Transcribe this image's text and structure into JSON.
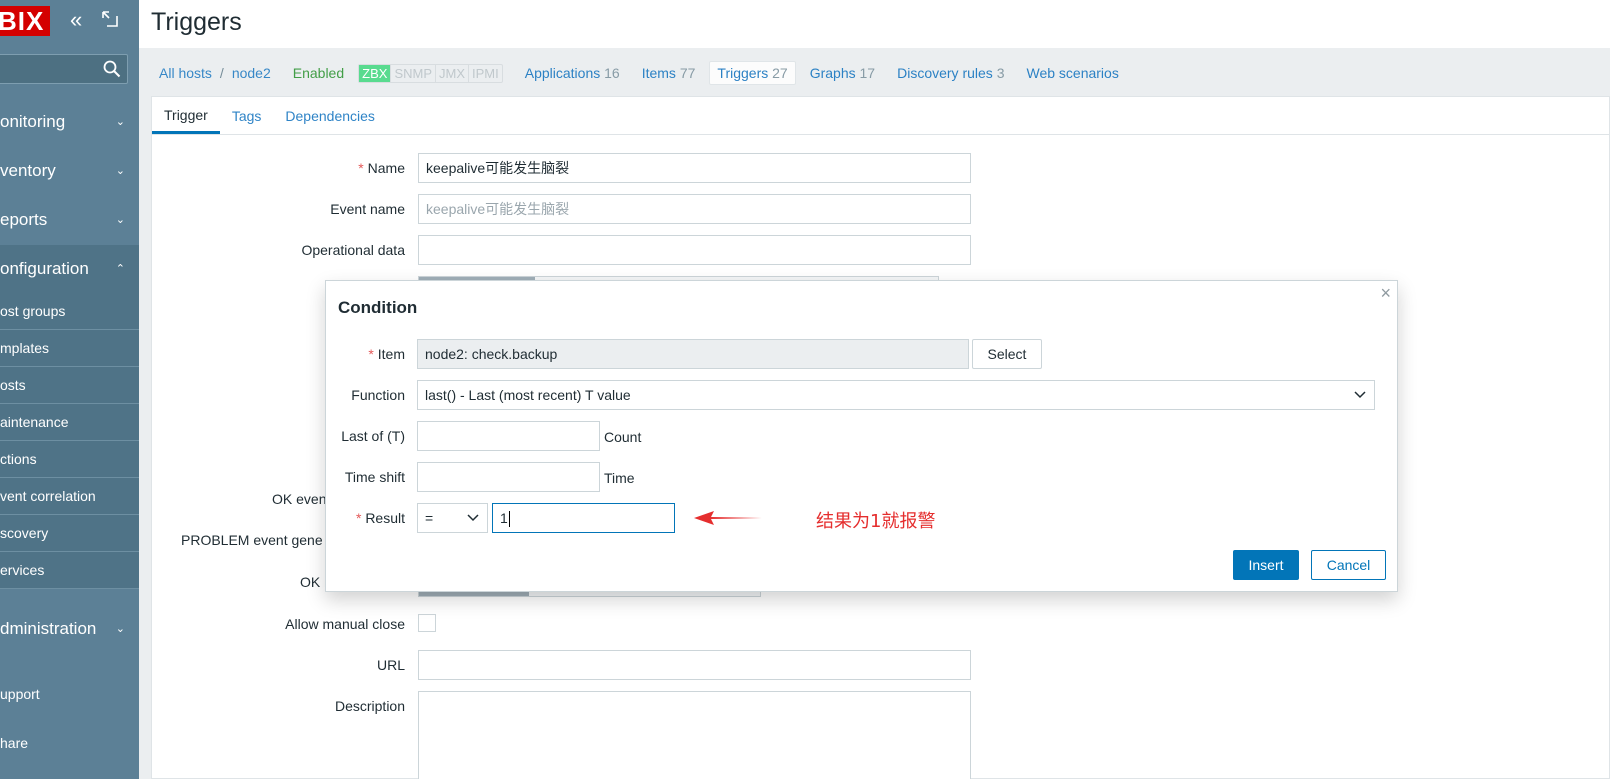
{
  "sidebar": {
    "logo": "BIX",
    "search_placeholder": "",
    "menu": [
      {
        "label": "onitoring",
        "chevron": "⌄"
      },
      {
        "label": "ventory",
        "chevron": "⌄"
      },
      {
        "label": "eports",
        "chevron": "⌄"
      },
      {
        "label": "onfiguration",
        "chevron": "⌃"
      },
      {
        "label": "dministration",
        "chevron": "⌄"
      }
    ],
    "submenu": [
      "ost groups",
      "mplates",
      "osts",
      "aintenance",
      "ctions",
      "vent correlation",
      "scovery",
      "ervices"
    ],
    "support": "upport",
    "share": "hare"
  },
  "page": {
    "title": "Triggers"
  },
  "host_nav": {
    "all_hosts": "All hosts",
    "separator": "/",
    "host": "node2",
    "status": "Enabled",
    "availability": [
      "ZBX",
      "SNMP",
      "JMX",
      "IPMI"
    ],
    "tabs": [
      {
        "label": "Applications",
        "count": "16"
      },
      {
        "label": "Items",
        "count": "77"
      },
      {
        "label": "Triggers",
        "count": "27"
      },
      {
        "label": "Graphs",
        "count": "17"
      },
      {
        "label": "Discovery rules",
        "count": "3"
      },
      {
        "label": "Web scenarios",
        "count": ""
      }
    ]
  },
  "form_tabs": [
    "Trigger",
    "Tags",
    "Dependencies"
  ],
  "form": {
    "name_label": "Name",
    "name_value": "keepalive可能发生脑裂",
    "event_name_label": "Event name",
    "event_name_placeholder": "keepalive可能发生脑裂",
    "operational_data_label": "Operational data",
    "ok_event_label": "OK even",
    "problem_event_label": "PROBLEM event gene",
    "ok_label": "OK",
    "allow_manual_close_label": "Allow manual close",
    "url_label": "URL",
    "description_label": "Description"
  },
  "modal": {
    "title": "Condition",
    "close": "×",
    "item_label": "Item",
    "item_value": "node2: check.backup",
    "select_button": "Select",
    "function_label": "Function",
    "function_value": "last() - Last (most recent) T value",
    "last_of_label": "Last of (T)",
    "last_of_value": "",
    "last_of_unit": "Count",
    "time_shift_label": "Time shift",
    "time_shift_value": "",
    "time_shift_unit": "Time",
    "result_label": "Result",
    "operator_value": "=",
    "result_value": "1",
    "insert_button": "Insert",
    "cancel_button": "Cancel",
    "annotation": "结果为1就报警"
  },
  "colors": {
    "sidebar": "#5c8096",
    "primary": "#0275b8",
    "required": "#e45959",
    "annotation": "#e52e2e",
    "zbx_available": "#59db8f"
  }
}
